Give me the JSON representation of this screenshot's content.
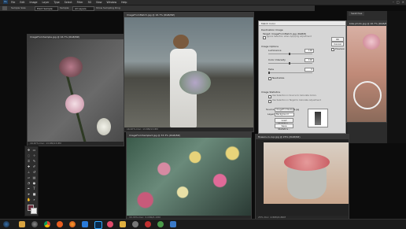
{
  "menubar": {
    "app_logo": "Ps",
    "items": [
      "File",
      "Edit",
      "Image",
      "Layer",
      "Type",
      "Select",
      "Filter",
      "3D",
      "View",
      "Window",
      "Help"
    ],
    "window_controls": [
      "–",
      "□",
      "×"
    ]
  },
  "optionsbar": {
    "tool_label": "Sample Size:",
    "sample_size": "Point Sample",
    "sample_label": "Sample:",
    "sample_value": "All Layers",
    "show_ring": "Show Sampling Ring"
  },
  "rightpanel": {
    "tab": "Swatches"
  },
  "documents": [
    {
      "title": "ImageFromSample.jpg @ 16.7% (RGB/8#)",
      "status": "16.67%   Doc: 13.8M/13.8M"
    },
    {
      "title": "ImageFromMatch.jpg @ 16.7% (RGB/8#)",
      "status": "16.67%   Doc: 13.8M/13.8M"
    },
    {
      "title": "ImageFromSample3.jpg @ 33.3% (RGB/8#)",
      "status": "33.33%   Doc: 3.15M/3.15M"
    },
    {
      "title": "flowers-in-cup.jpg @ 25% (RGB/8#)",
      "status": "25%   Doc: 4.86M/4.86M"
    },
    {
      "title": "bike-photo.jpg @ 16.7% (RGB/8#)",
      "status": ""
    }
  ],
  "dialog": {
    "title": "Match Color",
    "section_dest": "Destination Image",
    "target_label": "Target:",
    "target_value": "ImageFromMatch.jpg (RGB/8)",
    "ignore_selection": "Ignore Selection when Applying Adjustment",
    "section_options": "Image Options",
    "luminance_label": "Luminance",
    "luminance_value": "100",
    "intensity_label": "Color Intensity",
    "intensity_value": "100",
    "fade_label": "Fade",
    "fade_value": "0",
    "neutralize_label": "Neutralize",
    "section_stats": "Image Statistics",
    "use_sel_source": "Use Selection in Source to Calculate Colors",
    "use_sel_target": "Use Selection in Target to Calculate Adjustment",
    "source_label": "Source:",
    "source_value": "ImageFromSample.jpg",
    "layer_label": "Layer:",
    "layer_value": "Background",
    "load_stats": "Load Statistics...",
    "save_stats": "Save Statistics...",
    "ok_label": "OK",
    "cancel_label": "Cancel",
    "preview_label": "Preview"
  },
  "taskbar": {
    "icons": [
      "start-icon",
      "explorer-icon",
      "camera-icon",
      "chrome-icon",
      "media-icon",
      "firefox-icon",
      "app-icon",
      "photoshop-icon",
      "music-icon",
      "folder-icon",
      "settings-icon",
      "video-icon",
      "game-icon",
      "mail-icon"
    ]
  }
}
